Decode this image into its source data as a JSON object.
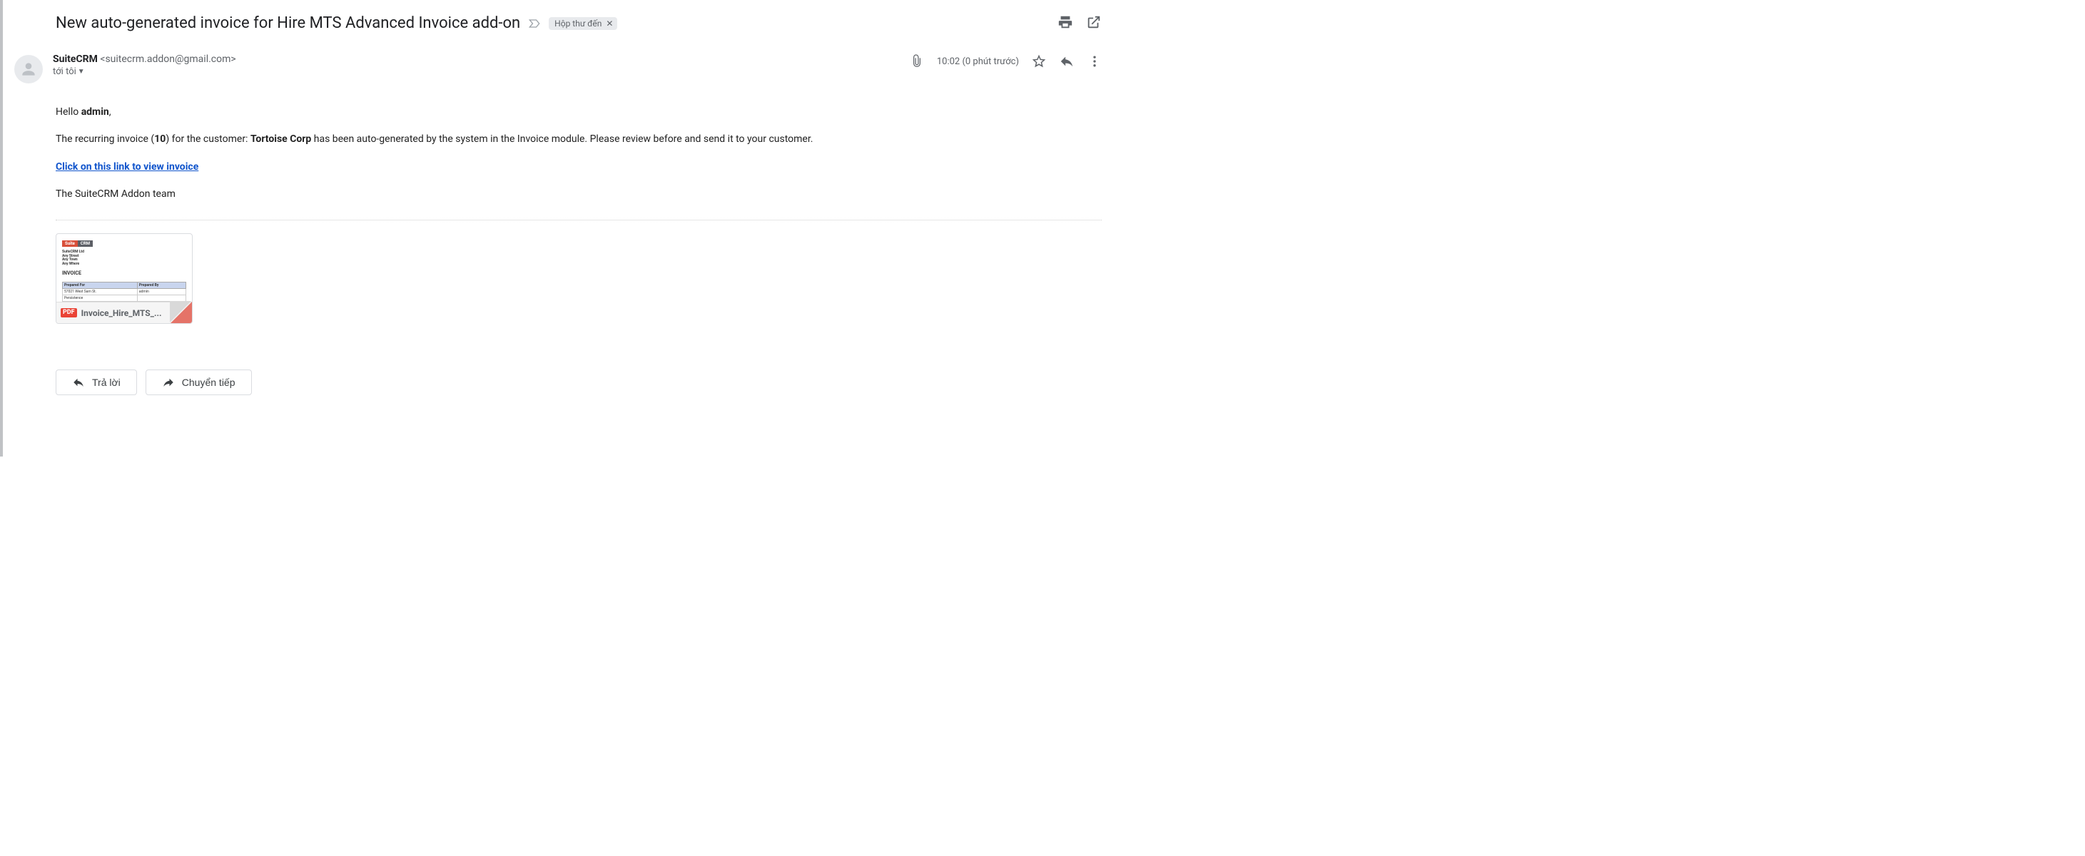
{
  "header": {
    "subject": "New auto-generated invoice for Hire MTS Advanced Invoice add-on",
    "inbox_label": "Hộp thư đến"
  },
  "sender": {
    "name": "SuiteCRM",
    "email_display": "<suitecrm.addon@gmail.com>",
    "to_line": "tới tôi"
  },
  "meta": {
    "time": "10:02 (0 phút trước)"
  },
  "body": {
    "hello_prefix": "Hello ",
    "hello_name": "admin",
    "hello_suffix": ",",
    "line2_a": "The recurring invoice (",
    "line2_num": "10",
    "line2_b": ") for the customer:  ",
    "line2_customer": "Tortoise Corp",
    "line2_c": " has been auto-generated by the system in the Invoice module. Please review before and send it to your customer.",
    "link_text": "Click on this link to view invoice",
    "signature": "The SuiteCRM Addon team"
  },
  "attachment": {
    "filename": "Invoice_Hire_MTS_...",
    "pdf_label": "PDF",
    "preview": {
      "brand1": "Suite",
      "brand2": "CRM",
      "addr1": "SuiteCRM Ltd",
      "addr2": "Any Street",
      "addr3": "Any Town",
      "addr4": "Any Where",
      "title": "INVOICE",
      "th1": "Prepared For",
      "th2": "Prepared By",
      "td1": "57021 West Sam St.",
      "td2": "admin",
      "td3": "Persistence"
    }
  },
  "buttons": {
    "reply": "Trả lời",
    "forward": "Chuyển tiếp"
  }
}
